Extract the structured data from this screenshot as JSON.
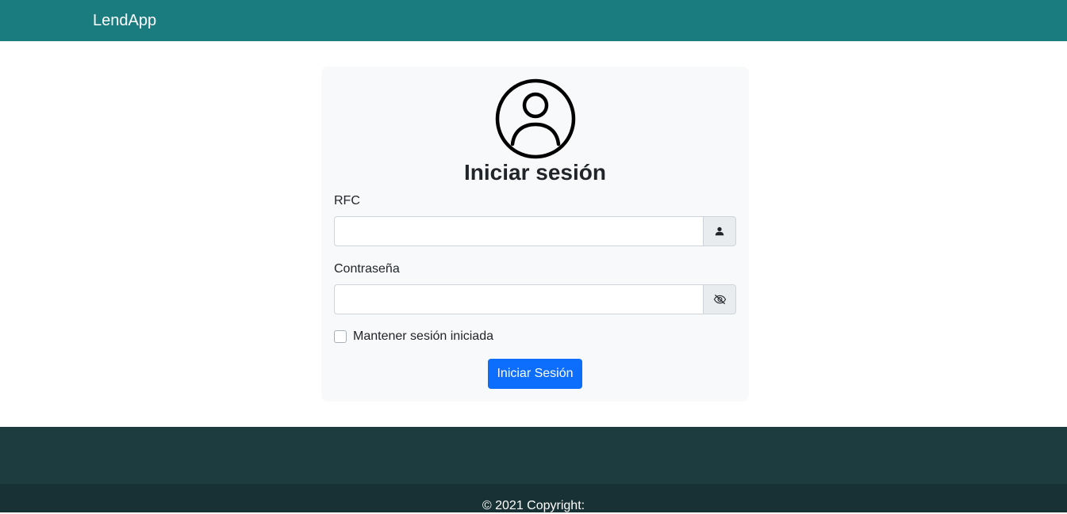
{
  "navbar": {
    "brand": "LendApp",
    "background": "#1b7c80"
  },
  "login": {
    "avatar_icon": "person-circle-icon",
    "title": "Iniciar sesión",
    "rfc": {
      "label": "RFC",
      "value": "",
      "addon_icon": "person-icon"
    },
    "password": {
      "label": "Contraseña",
      "value": "",
      "addon_icon": "eye-slash-icon"
    },
    "remember": {
      "label": "Mantener sesión iniciada",
      "checked": false
    },
    "submit_label": "Iniciar Sesión",
    "submit_color": "#0d6efd"
  },
  "footer": {
    "copyright": "© 2021 Copyright:",
    "colors": [
      "#1c3c40",
      "#183134"
    ]
  }
}
